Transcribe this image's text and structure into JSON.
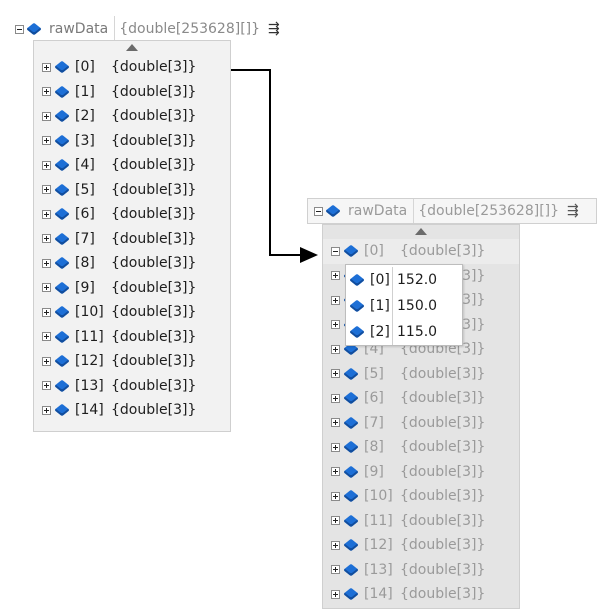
{
  "left_tip": {
    "name": "rawData",
    "type": "{double[253628][]}",
    "rows": [
      {
        "index": "[0]",
        "value": "{double[3]}"
      },
      {
        "index": "[1]",
        "value": "{double[3]}"
      },
      {
        "index": "[2]",
        "value": "{double[3]}"
      },
      {
        "index": "[3]",
        "value": "{double[3]}"
      },
      {
        "index": "[4]",
        "value": "{double[3]}"
      },
      {
        "index": "[5]",
        "value": "{double[3]}"
      },
      {
        "index": "[6]",
        "value": "{double[3]}"
      },
      {
        "index": "[7]",
        "value": "{double[3]}"
      },
      {
        "index": "[8]",
        "value": "{double[3]}"
      },
      {
        "index": "[9]",
        "value": "{double[3]}"
      },
      {
        "index": "[10]",
        "value": "{double[3]}"
      },
      {
        "index": "[11]",
        "value": "{double[3]}"
      },
      {
        "index": "[12]",
        "value": "{double[3]}"
      },
      {
        "index": "[13]",
        "value": "{double[3]}"
      },
      {
        "index": "[14]",
        "value": "{double[3]}"
      }
    ]
  },
  "right_tip": {
    "name": "rawData",
    "type": "{double[253628][]}",
    "rows": [
      {
        "index": "[0]",
        "value": "{double[3]}"
      },
      {
        "index": "[1]",
        "value": "{double[3]}"
      },
      {
        "index": "[2]",
        "value": "{double[3]}"
      },
      {
        "index": "[3]",
        "value": "{double[3]}"
      },
      {
        "index": "[4]",
        "value": "{double[3]}"
      },
      {
        "index": "[5]",
        "value": "{double[3]}"
      },
      {
        "index": "[6]",
        "value": "{double[3]}"
      },
      {
        "index": "[7]",
        "value": "{double[3]}"
      },
      {
        "index": "[8]",
        "value": "{double[3]}"
      },
      {
        "index": "[9]",
        "value": "{double[3]}"
      },
      {
        "index": "[10]",
        "value": "{double[3]}"
      },
      {
        "index": "[11]",
        "value": "{double[3]}"
      },
      {
        "index": "[12]",
        "value": "{double[3]}"
      },
      {
        "index": "[13]",
        "value": "{double[3]}"
      },
      {
        "index": "[14]",
        "value": "{double[3]}"
      }
    ],
    "expanded_popup": [
      {
        "index": "[0]",
        "value": "152.0"
      },
      {
        "index": "[1]",
        "value": "150.0"
      },
      {
        "index": "[2]",
        "value": "115.0"
      }
    ]
  },
  "icons": {
    "collapse": "minus-box-icon",
    "expand": "plus-box-icon",
    "field": "field-cube-icon",
    "pin": "pin-icon"
  },
  "colors": {
    "cube_blue": "#1d6fd6",
    "dim_text": "#9a9a9a",
    "arrow": "#000000"
  }
}
